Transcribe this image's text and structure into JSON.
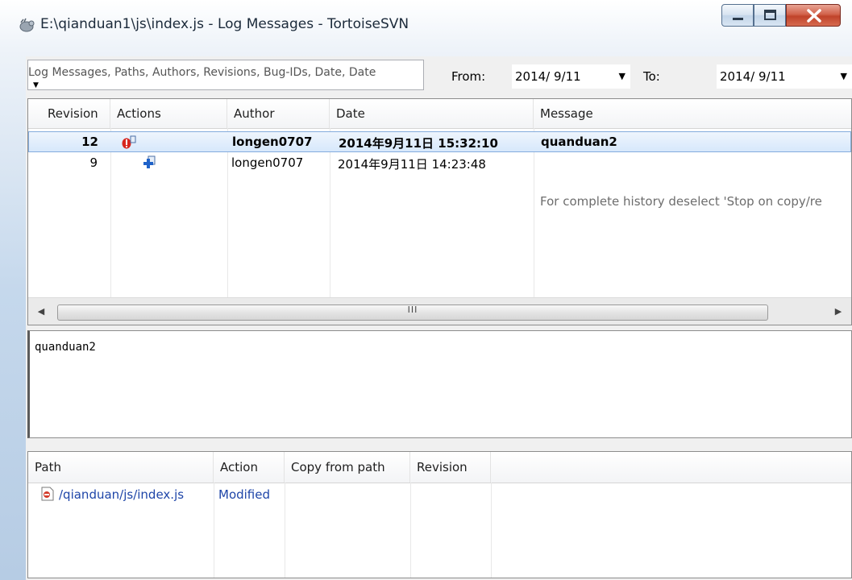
{
  "window": {
    "title": "E:\\qianduan1\\js\\index.js - Log Messages - TortoiseSVN",
    "minimize_glyph": "▁",
    "maximize_glyph": "▢",
    "close_glyph": "X"
  },
  "filter": {
    "search_text": "Log Messages, Paths, Authors, Revisions, Bug-IDs, Date, Date",
    "from_label": "From:",
    "from_value": "2014/ 9/11",
    "to_label": "To:",
    "to_value": "2014/ 9/11"
  },
  "log": {
    "columns": [
      "Revision",
      "Actions",
      "Author",
      "Date",
      "Message"
    ],
    "rows": [
      {
        "revision": "12",
        "action_icon": "deleted-icon",
        "author": "longen0707",
        "date": "2014年9月11日 15:32:10",
        "message": "quanduan2",
        "selected": true
      },
      {
        "revision": "9",
        "action_icon": "added-icon",
        "author": "longen0707",
        "date": "2014年9月11日 14:23:48",
        "message": "",
        "selected": false
      }
    ],
    "history_note": "For complete history deselect 'Stop on copy/re"
  },
  "scrollbar": {
    "left_arrow": "◀",
    "right_arrow": "▶",
    "grip": "III"
  },
  "message_pane": {
    "text": "quanduan2"
  },
  "paths": {
    "columns": [
      "Path",
      "Action",
      "Copy from path",
      "Revision"
    ],
    "rows": [
      {
        "path": "/qianduan/js/index.js",
        "action": "Modified",
        "copy_from": "",
        "revision": ""
      }
    ]
  }
}
